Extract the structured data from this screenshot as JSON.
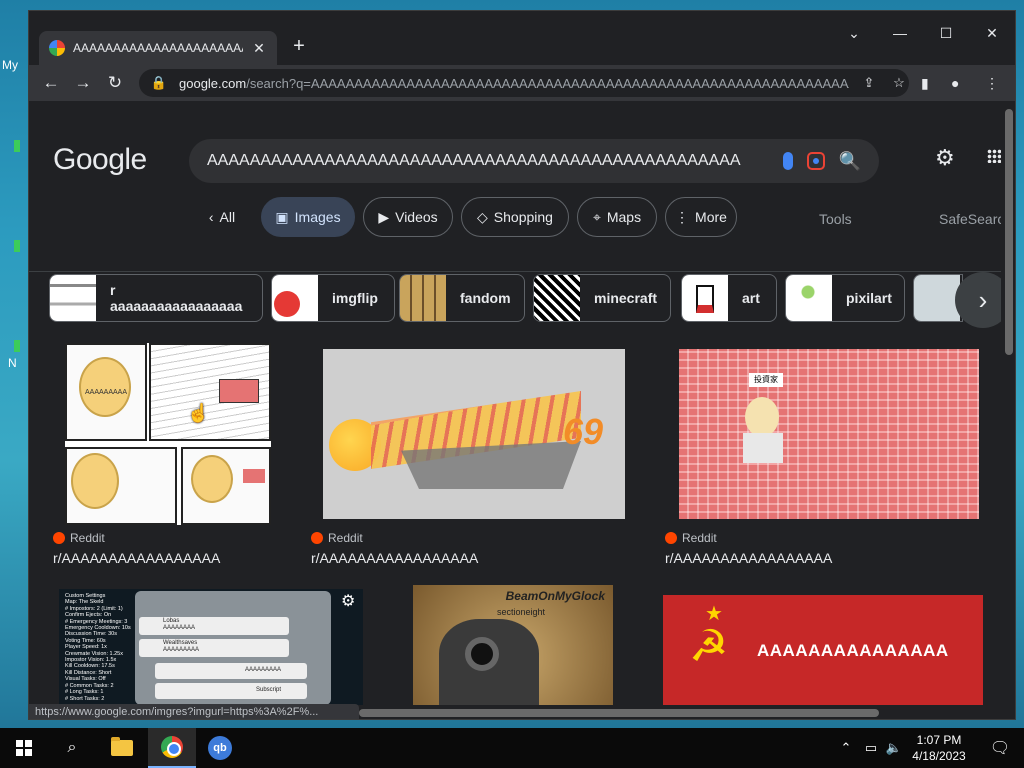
{
  "desktop": {
    "frag1": "My",
    "frag2": "N"
  },
  "tab": {
    "title": "AAAAAAAAAAAAAAAAAAAAAAAAAAAA",
    "close": "✕"
  },
  "window_controls": {
    "tabsearch": "⌄",
    "minimize": "—",
    "maximize": "☐",
    "close": "✕"
  },
  "toolbar": {
    "back": "←",
    "forward": "→",
    "reload": "↻",
    "url_host": "google.com",
    "url_path": "/search?q=AAAAAAAAAAAAAAAAAAAAAAAAAAAAAAAAAAAAAAAAAAAAAAAAAAAAAAAAAAAAAAA!!!!..."
  },
  "google": {
    "logo": "Google",
    "query": "AAAAAAAAAAAAAAAAAAAAAAAAAAAAAAAAAAAAAAAAAAAAAAAAAA",
    "nav": [
      {
        "label": "All",
        "icon": "‹"
      },
      {
        "label": "Images",
        "icon": "▣"
      },
      {
        "label": "Videos",
        "icon": "▶"
      },
      {
        "label": "Shopping",
        "icon": "◇"
      },
      {
        "label": "Maps",
        "icon": "⌖"
      },
      {
        "label": "More",
        "icon": "⋮"
      }
    ],
    "tools": "Tools",
    "safesearch": "SafeSearch"
  },
  "suggestions": [
    {
      "label": "r aaaaaaaaaaaaaaaaa"
    },
    {
      "label": "imgflip"
    },
    {
      "label": "fandom"
    },
    {
      "label": "minecraft"
    },
    {
      "label": "art"
    },
    {
      "label": "pixilart"
    }
  ],
  "results": [
    {
      "source": "Reddit",
      "title": "r/AAAAAAAAAAAAAAAAA"
    },
    {
      "source": "Reddit",
      "title": "r/AAAAAAAAAAAAAAAAA"
    },
    {
      "source": "Reddit",
      "title": "r/AAAAAAAAAAAAAAAAA"
    }
  ],
  "images": {
    "yellow_text": "AAAAAAAAA",
    "number": "69",
    "cosmic_label": "BeamOnMyGlock",
    "cosmic_sub": "sectioneight",
    "flag_text": "AAAAAAAAAAAAAAA",
    "sign": "投資家",
    "among_us_lines": [
      "Custom Settings",
      "Map: The Skeld",
      "# Impostors: 2 (Limit: 1)",
      "Confirm Ejects: On",
      "# Emergency Meetings: 3",
      "Emergency Cooldown: 10s",
      "Discussion Time: 30s",
      "Voting Time: 60s",
      "Player Speed: 1x",
      "Crewmate Vision: 1.25x",
      "Impostor Vision: 1.5x",
      "Kill Cooldown: 17.5s",
      "Kill Distance: Short",
      "Visual Tasks: Off",
      "# Common Tasks: 2",
      "# Long Tasks: 1",
      "# Short Tasks: 2"
    ],
    "among_us_names": [
      "Lobas",
      "Wealthsaves"
    ],
    "among_us_msg": "AAAAAAAA",
    "among_us_msg2": "AAAAAAAAA",
    "among_us_right": "AAAAAAAAA",
    "among_us_sub": "Subscript"
  },
  "status_url": "https://www.google.com/imgres?imgurl=https%3A%2F%...",
  "taskbar": {
    "time": "1:07 PM",
    "date": "4/18/2023",
    "qb": "qb"
  },
  "colors": {
    "accent": "#8ab4f8",
    "reddit": "#ff4500",
    "bg": "#202124"
  }
}
